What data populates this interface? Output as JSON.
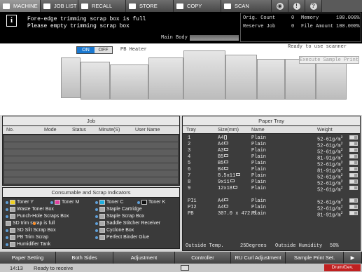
{
  "tabs": [
    {
      "label": "MACHINE",
      "icon": "machine-icon",
      "selected": true
    },
    {
      "label": "JOB LIST",
      "icon": "job-list-icon"
    },
    {
      "label": "RECALL",
      "icon": "recall-icon"
    },
    {
      "label": "STORE",
      "icon": "store-icon"
    },
    {
      "label": "COPY",
      "icon": "copy-icon"
    },
    {
      "label": "SCAN",
      "icon": "scan-icon"
    }
  ],
  "header_icons": [
    "network-icon",
    "alarm-icon",
    "help-icon"
  ],
  "warning": {
    "line1": "Fore-edge trimming scrap box is full",
    "line2": "Please empty trimming scrap box"
  },
  "counters": {
    "orig_count_label": "Orig. Count",
    "orig_count": "0",
    "memory_label": "Memory",
    "memory": "100.000%",
    "reserve_job_label": "Reserve Job",
    "reserve_job": "0",
    "file_amount_label": "File Amount",
    "file_amount": "100.000%"
  },
  "main_body_label": "Main Body",
  "pb_heater": {
    "on": "ON",
    "off": "OFF",
    "label": "PB Heater",
    "state": "ON"
  },
  "scanner_status": "Ready to use scanner",
  "execute_sample_print": "Execute Sample Print",
  "job_panel": {
    "title": "Job",
    "columns": [
      "No.",
      "Mode",
      "Status",
      "Minute(S)",
      "User Name"
    ]
  },
  "consumables": {
    "title": "Consumable and Scrap Indicators",
    "items": [
      {
        "label": "Toner Y",
        "color": "#f0d020"
      },
      {
        "label": "Toner M",
        "color": "#e040a0"
      },
      {
        "label": "Toner C",
        "color": "#20b0e0"
      },
      {
        "label": "Toner K",
        "color": "#111111"
      },
      {
        "label": "Waste Toner Box"
      },
      {
        "label": "Staple Cartridge"
      },
      {
        "label": "Punch-Hole Scraps Box"
      },
      {
        "label": "Staple Scrap Box"
      },
      {
        "label": "SD trim scrap is full",
        "warning": true
      },
      {
        "label": "Saddle Stitcher Receiver"
      },
      {
        "label": "SD Slit Scrap Box"
      },
      {
        "label": "Cyclone Box"
      },
      {
        "label": "PB Trim Scrap"
      },
      {
        "label": "Perfect Binder Glue"
      },
      {
        "label": "Humidifier Tank"
      }
    ]
  },
  "paper_tray": {
    "title": "Paper Tray",
    "columns": [
      "Tray",
      "Size(mm)",
      "Name",
      "Weight"
    ],
    "rows": [
      {
        "tray": "1",
        "size": "A4",
        "orient": "portrait",
        "name": "Plain",
        "weight": "52-61g/m",
        "level": 0.6
      },
      {
        "tray": "2",
        "size": "A4",
        "orient": "landscape",
        "name": "Plain",
        "weight": "52-61g/m",
        "level": 0.6
      },
      {
        "tray": "3",
        "size": "A3",
        "orient": "landscape",
        "name": "Plain",
        "weight": "52-61g/m",
        "level": 0.6
      },
      {
        "tray": "4",
        "size": "B5",
        "orient": "landscape",
        "name": "Plain",
        "weight": "81-91g/m",
        "level": 0.6
      },
      {
        "tray": "5",
        "size": "B5",
        "orient": "landscape",
        "name": "Plain",
        "weight": "52-61g/m",
        "level": 0.6
      },
      {
        "tray": "6",
        "size": "B4",
        "orient": "landscape",
        "name": "Plain",
        "weight": "81-91g/m",
        "level": 0.6
      },
      {
        "tray": "7",
        "size": "8.5x11",
        "orient": "landscape",
        "name": "Plain",
        "weight": "52-61g/m",
        "level": 0.6
      },
      {
        "tray": "8",
        "size": "9x11",
        "orient": "landscape",
        "name": "Plain",
        "weight": "52-61g/m",
        "level": 0.6
      },
      {
        "tray": "9",
        "size": "12x18",
        "orient": "landscape",
        "name": "Plain",
        "weight": "52-61g/m",
        "level": 0.6
      },
      {
        "tray": "PI1",
        "size": "A4",
        "orient": "landscape",
        "name": "Plain",
        "weight": "52-61g/m",
        "level": 0.6
      },
      {
        "tray": "PI2",
        "size": "A4",
        "orient": "landscape",
        "name": "Plain",
        "weight": "52-61g/m",
        "level": 0.6
      },
      {
        "tray": "PB",
        "size": "307.0 x 472.0",
        "name": "Plain",
        "weight": "81-91g/m",
        "level": 0.6
      }
    ],
    "weight_exp": "2"
  },
  "environment": {
    "temp_label": "Outside Temp.",
    "temp": "25Degrees",
    "humidity_label": "Outside Humidity",
    "humidity": "50%"
  },
  "bottom_buttons": [
    "Paper Setting",
    "Both Sides",
    "Adjustment",
    "Controller",
    "RU Curl Adjustment",
    "Sample Print Set."
  ],
  "status_bar": {
    "time": "14:13",
    "message": "Ready to receive",
    "alert": "Drum/Dev."
  }
}
